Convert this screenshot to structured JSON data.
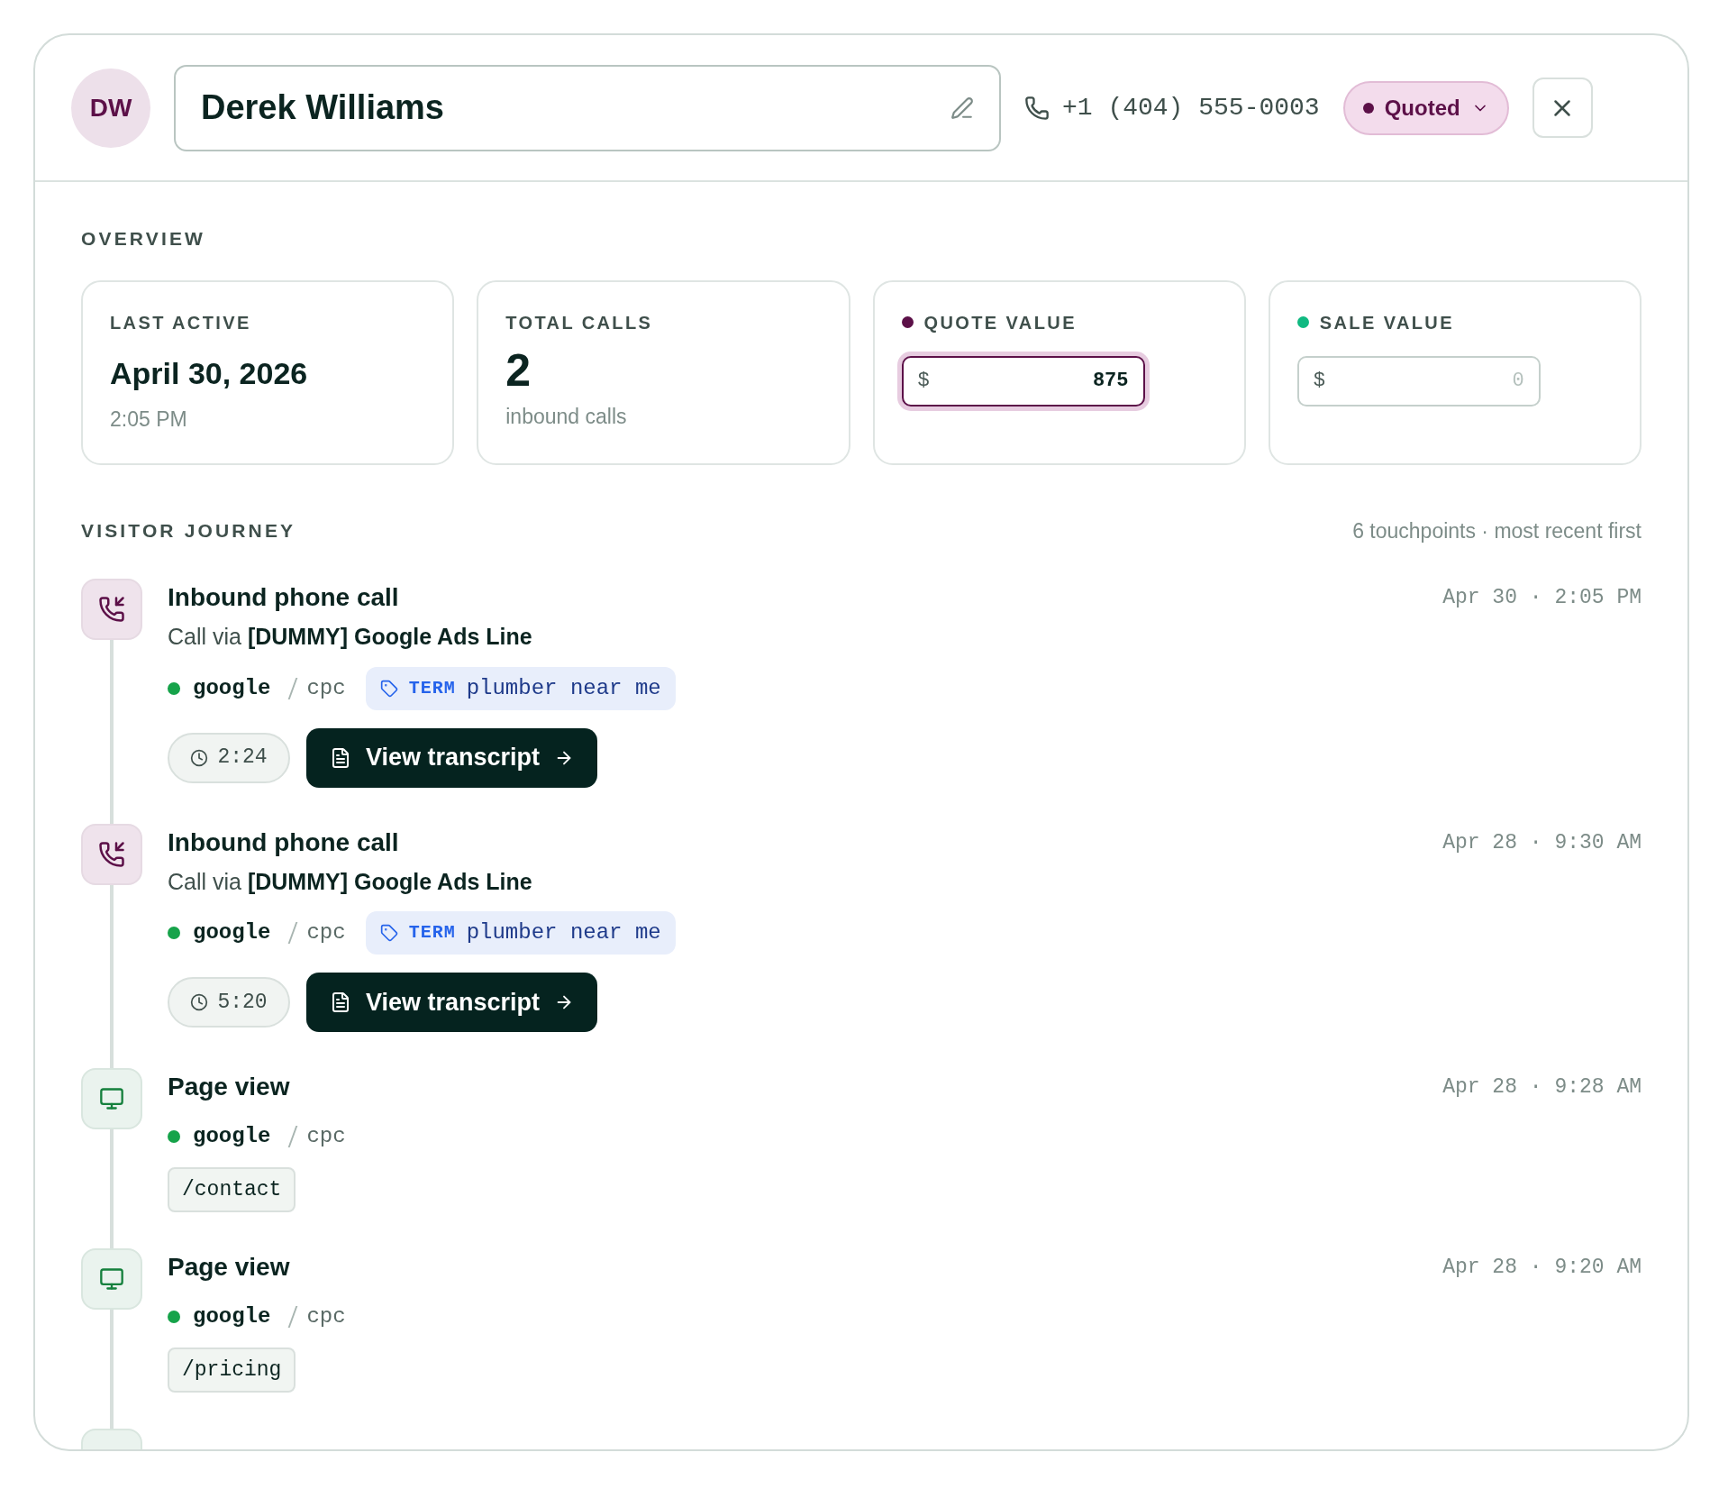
{
  "header": {
    "avatar_initials": "DW",
    "name": "Derek Williams",
    "phone": "+1 (404) 555-0003",
    "status": {
      "label": "Quoted",
      "color": "#5c1048"
    }
  },
  "overview": {
    "title": "OVERVIEW",
    "cards": [
      {
        "kind": "text",
        "label": "LAST ACTIVE",
        "value": "April 30, 2026",
        "sub": "2:05 PM"
      },
      {
        "kind": "count",
        "label": "TOTAL CALLS",
        "value": "2",
        "sub": "inbound calls"
      },
      {
        "kind": "money",
        "label": "QUOTE VALUE",
        "color": "#5c1048",
        "currency": "$",
        "value": "875",
        "focused": true
      },
      {
        "kind": "money",
        "label": "SALE VALUE",
        "color": "#10b981",
        "currency": "$",
        "placeholder": "0",
        "focused": false
      }
    ]
  },
  "journey": {
    "title": "VISITOR JOURNEY",
    "summary": "6 touchpoints · most recent first",
    "items": [
      {
        "kind": "call",
        "title": "Inbound phone call",
        "via": "Call via **[DUMMY] Google Ads Line**",
        "time": "Apr 30 · 2:05 PM",
        "source": "google",
        "color": "#16a34a",
        "medium": "cpc",
        "term_label": "TERM",
        "term": "plumber near me",
        "duration": "2:24",
        "action": "View transcript"
      },
      {
        "kind": "call",
        "title": "Inbound phone call",
        "via": "Call via **[DUMMY] Google Ads Line**",
        "time": "Apr 28 · 9:30 AM",
        "source": "google",
        "color": "#16a34a",
        "medium": "cpc",
        "term_label": "TERM",
        "term": "plumber near me",
        "duration": "5:20",
        "action": "View transcript"
      },
      {
        "kind": "page",
        "title": "Page view",
        "time": "Apr 28 · 9:28 AM",
        "source": "google",
        "color": "#16a34a",
        "medium": "cpc",
        "path": "/contact"
      },
      {
        "kind": "page",
        "title": "Page view",
        "time": "Apr 28 · 9:20 AM",
        "source": "google",
        "color": "#16a34a",
        "medium": "cpc",
        "path": "/pricing"
      }
    ]
  }
}
